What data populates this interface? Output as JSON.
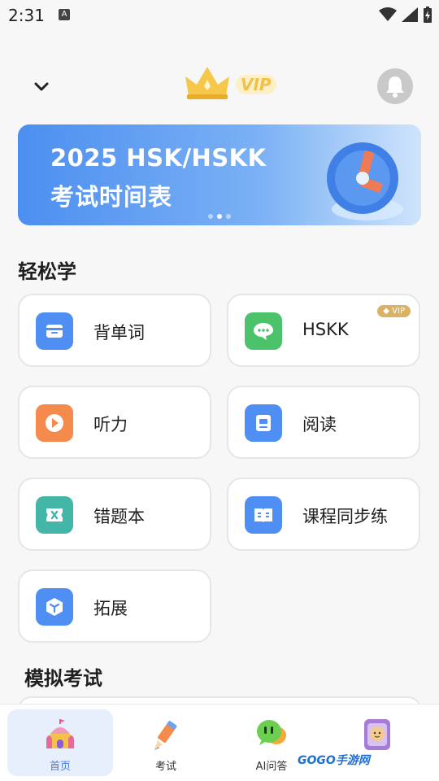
{
  "status_bar": {
    "time": "2:31",
    "notification_letter": "A"
  },
  "header": {
    "vip_text": "VIP"
  },
  "banner": {
    "line1": "2025 HSK/HSKK",
    "line2": "考试时间表"
  },
  "sections": {
    "easy_learn": "轻松学",
    "mock_exam": "模拟考试"
  },
  "features": [
    {
      "label": "背单词",
      "icon": "card-icon",
      "color": "#4f8ef2"
    },
    {
      "label": "HSKK",
      "icon": "chat-bubble-icon",
      "color": "#4cc26a",
      "badge": "VIP"
    },
    {
      "label": "听力",
      "icon": "play-icon",
      "color": "#f48a4c"
    },
    {
      "label": "阅读",
      "icon": "reader-icon",
      "color": "#4f8ef2"
    },
    {
      "label": "错题本",
      "icon": "wrong-notebook-icon",
      "color": "#44b6a8"
    },
    {
      "label": "课程同步练",
      "icon": "book-icon",
      "color": "#4f8ef2"
    },
    {
      "label": "拓展",
      "icon": "cube-icon",
      "color": "#4f8ef2"
    }
  ],
  "tabs": [
    {
      "label": "首页",
      "icon": "home-castle-icon",
      "active": true
    },
    {
      "label": "考试",
      "icon": "pencil-icon",
      "active": false
    },
    {
      "label": "AI问答",
      "icon": "ai-chat-icon",
      "active": false
    },
    {
      "label": "",
      "icon": "profile-icon",
      "active": false
    }
  ],
  "watermark": "GOGO手游网"
}
